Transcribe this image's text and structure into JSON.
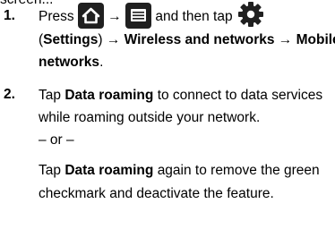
{
  "top_fragment": "screen...",
  "steps": [
    {
      "number": "1.",
      "press": "Press",
      "arrow1": "→",
      "and_then_tap": "and then tap",
      "settings_open": "(",
      "settings": "Settings",
      "settings_close": ")",
      "arrow2": "→",
      "wireless": "Wireless and networks",
      "arrow3": "→",
      "mobile": "Mobile",
      "networks": "networks",
      "period": "."
    },
    {
      "number": "2.",
      "tap1": "Tap",
      "data_roaming1": "Data roaming",
      "line1_rest": "to connect to data services",
      "line2": "while roaming outside your network.",
      "or": "– or –",
      "tap2": "Tap",
      "data_roaming2": "Data roaming",
      "line4_rest": "again to remove the green",
      "line5": "checkmark and deactivate the feature."
    }
  ],
  "icons": [
    "home-icon",
    "menu-icon",
    "settings-gear-icon"
  ],
  "colors": {
    "text": "#000000",
    "icon_bg": "#202020",
    "icon_fg": "#ffffff"
  }
}
